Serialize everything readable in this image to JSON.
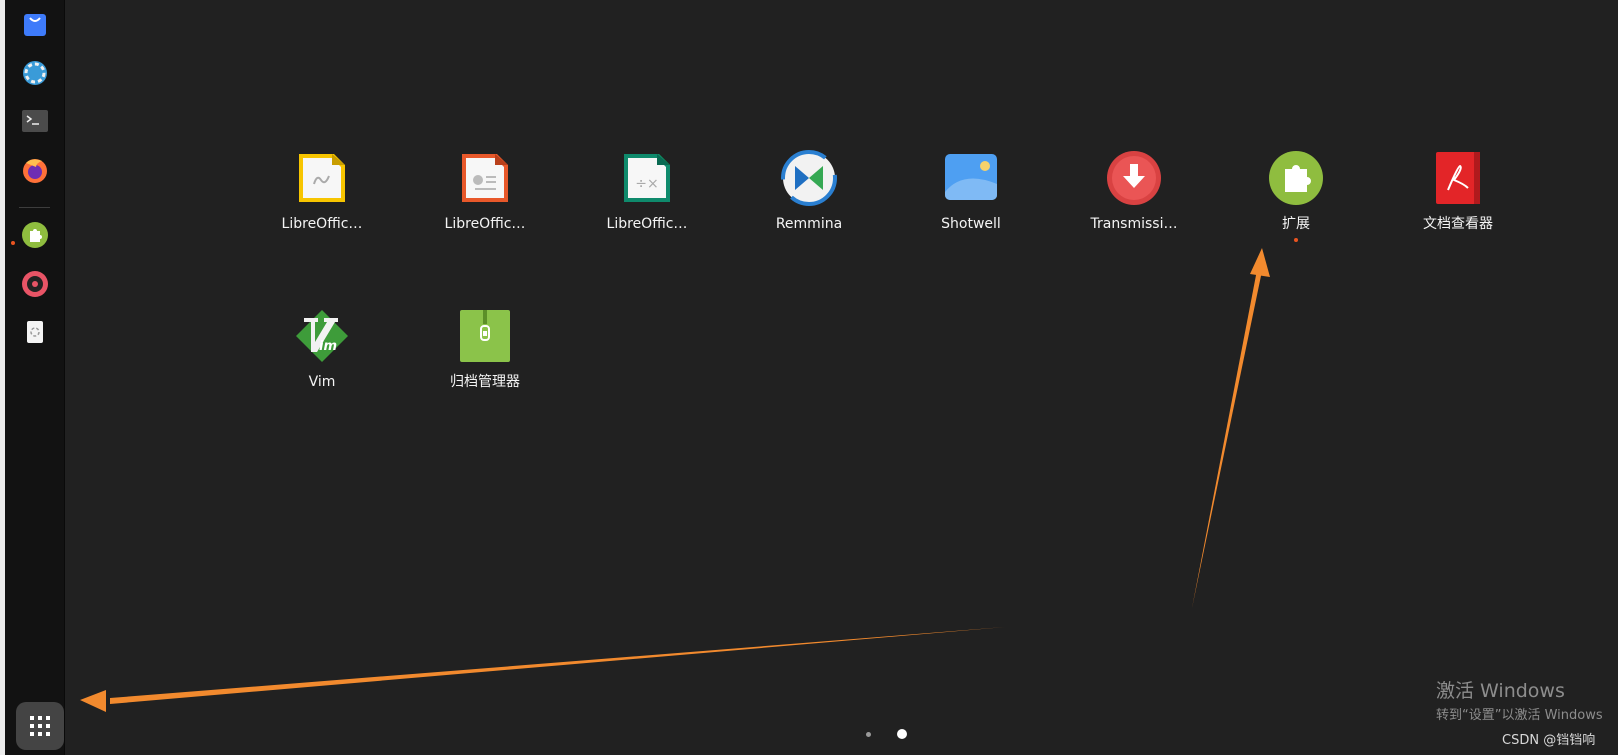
{
  "dock": {
    "items": [
      {
        "name": "ubuntu-software-icon"
      },
      {
        "name": "help-icon"
      },
      {
        "name": "terminal-icon"
      },
      {
        "name": "firefox-icon"
      },
      {
        "name": "extensions-icon"
      },
      {
        "name": "rhythmbox-icon"
      },
      {
        "name": "trash-icon"
      }
    ],
    "show_apps_icon": "grid-icon",
    "running_indicator_color": "#E95420"
  },
  "app_grid": {
    "apps": [
      {
        "label": "LibreOffic…",
        "icon": "libreoffice-writer-icon"
      },
      {
        "label": "LibreOffic…",
        "icon": "libreoffice-impress-icon"
      },
      {
        "label": "LibreOffic…",
        "icon": "libreoffice-calc-icon"
      },
      {
        "label": "Remmina",
        "icon": "remmina-icon"
      },
      {
        "label": "Shotwell",
        "icon": "shotwell-icon"
      },
      {
        "label": "Transmissi…",
        "icon": "transmission-icon"
      },
      {
        "label": "扩展",
        "icon": "extensions-icon"
      },
      {
        "label": "文档查看器",
        "icon": "document-viewer-icon"
      },
      {
        "label": "Vim",
        "icon": "vim-icon"
      },
      {
        "label": "归档管理器",
        "icon": "archive-manager-icon"
      }
    ],
    "pages": {
      "count": 2,
      "current": 2
    }
  },
  "watermark": {
    "title": "激活 Windows",
    "subtitle": "转到“设置”以激活 Windows"
  },
  "credit": "CSDN @铛铛响",
  "colors": {
    "background": "#212121",
    "dock": "#121212",
    "annotation_arrow": "#F28A2E",
    "accent": "#E95420"
  }
}
